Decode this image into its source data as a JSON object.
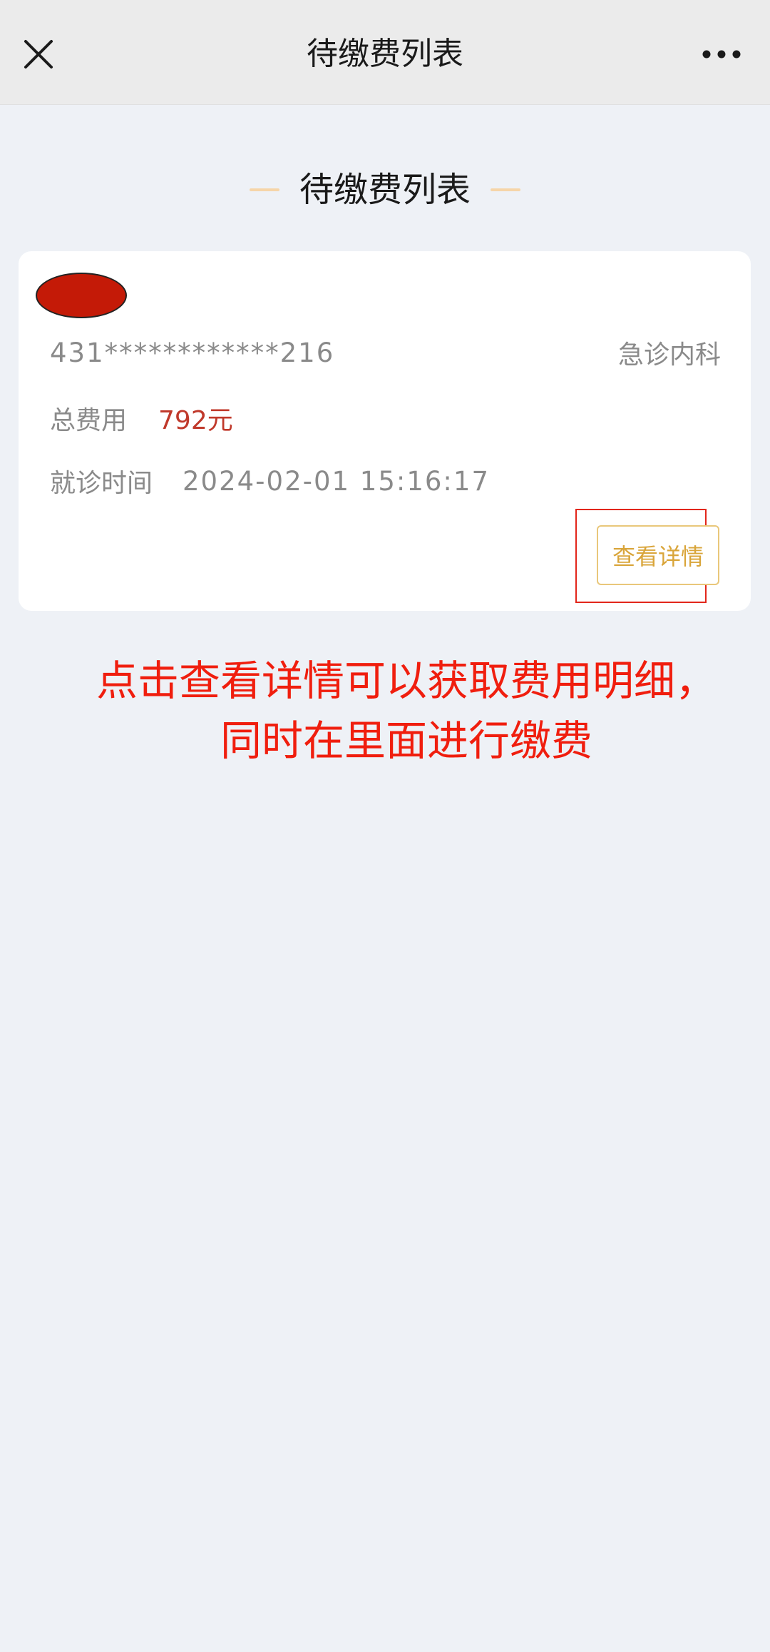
{
  "nav": {
    "title": "待缴费列表",
    "close_icon": "close-icon",
    "more_icon": "more-dots-icon"
  },
  "section": {
    "heading": "待缴费列表"
  },
  "bills": [
    {
      "patient_name": "",
      "id_number": "431************216",
      "department": "急诊内科",
      "total_fee_label": "总费用",
      "total_fee_value": "792元",
      "visit_time_label": "就诊时间",
      "visit_time_value": "2024-02-01  15:16:17",
      "detail_button_label": "查看详情"
    }
  ],
  "annotation": {
    "line1": "点击查看详情可以获取费用明细，",
    "line2": "同时在里面进行缴费"
  },
  "colors": {
    "background": "#eef1f6",
    "nav_background": "#ebebeb",
    "fee_value": "#c0392b",
    "button_border": "#e9c77a",
    "button_text": "#d9a53a",
    "annotation": "#f01e0e",
    "heading_dash": "#f6d5a8"
  }
}
